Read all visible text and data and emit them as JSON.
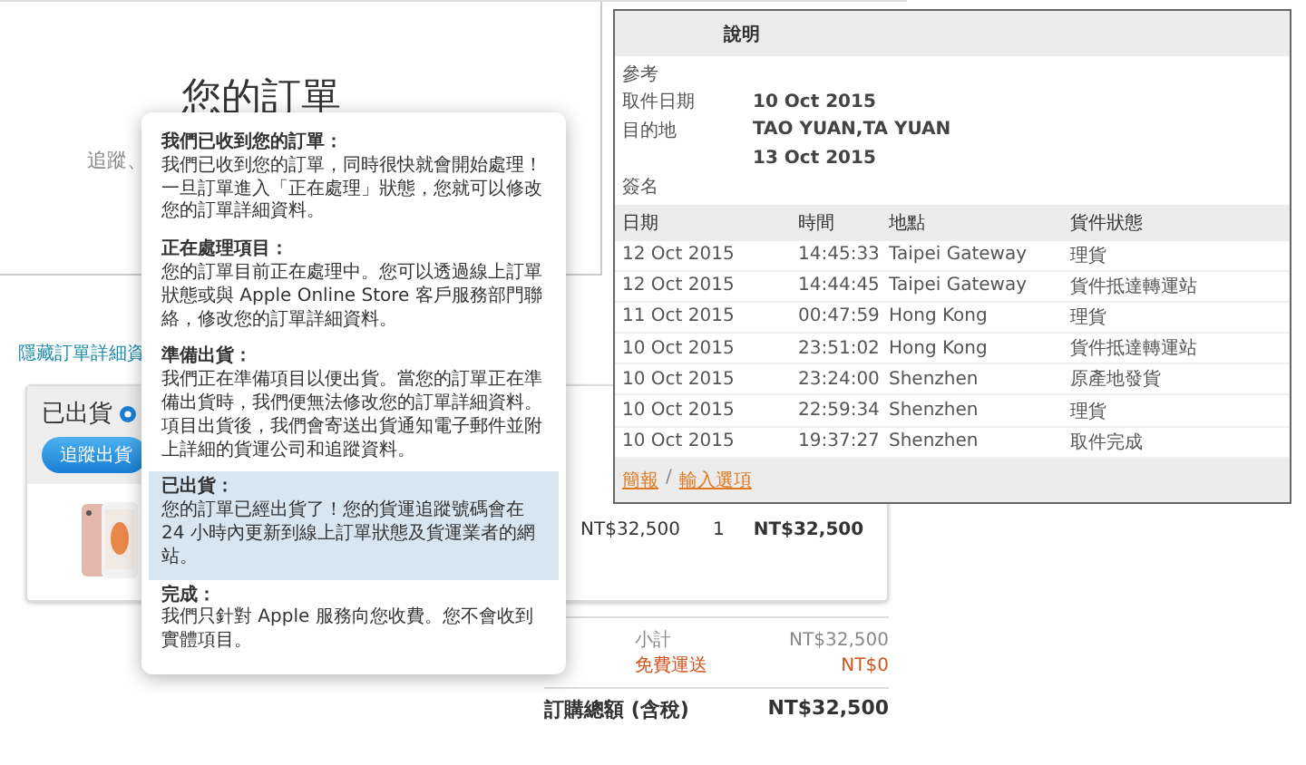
{
  "page": {
    "title": "您的訂單",
    "subtitle": "追蹤、",
    "hide_details_link": "隱藏訂單詳細資"
  },
  "shipment": {
    "status": "已出貨",
    "track_button": "追蹤出貨",
    "item": {
      "kind": "picture",
      "price": "NT$32,500",
      "quantity": "1",
      "total": "NT$32,500"
    }
  },
  "summary": [
    {
      "label": "小計",
      "value": "NT$32,500",
      "kind": "normal"
    },
    {
      "label": "免費運送",
      "value": "NT$0",
      "kind": "shipping"
    }
  ],
  "grand_total": {
    "label": "訂購總額 (含稅)",
    "value": "NT$32,500"
  },
  "status_popover": {
    "sections": [
      {
        "title": "我們已收到您的訂單：",
        "text": "我們已收到您的訂單，同時很快就會開始處理！一旦訂單進入「正在處理」狀態，您就可以修改您的訂單詳細資料。",
        "selected": false
      },
      {
        "title": "正在處理項目：",
        "text": "您的訂單目前正在處理中。您可以透過線上訂單狀態或與 Apple Online Store 客戶服務部門聯絡，修改您的訂單詳細資料。",
        "selected": false
      },
      {
        "title": "準備出貨：",
        "text": "我們正在準備項目以便出貨。當您的訂單正在準備出貨時，我們便無法修改您的訂單詳細資料。項目出貨後，我們會寄送出貨通知電子郵件並附上詳細的貨運公司和追蹤資料。",
        "selected": false
      },
      {
        "title": "已出貨：",
        "text": "您的訂單已經出貨了！您的貨運追蹤號碼會在 24 小時內更新到線上訂單狀態及貨運業者的網站。",
        "selected": true
      },
      {
        "title": "完成：",
        "text": "我們只針對 Apple 服務向您收費。您不會收到實體項目。",
        "selected": false
      }
    ]
  },
  "tracking": {
    "title": "說明",
    "details": [
      {
        "label": "參考"
      },
      {
        "label": "取件日期",
        "value": "10 Oct 2015"
      },
      {
        "label": "目的地",
        "value": "TAO YUAN,TA YUAN"
      },
      {
        "value": "13 Oct 2015"
      },
      {
        "label": "簽名"
      }
    ],
    "columns": [
      "日期",
      "時間",
      "地點",
      "貨件狀態"
    ],
    "rows": [
      [
        "12 Oct 2015",
        "14:45:33",
        "Taipei Gateway",
        "理貨"
      ],
      [
        "12 Oct 2015",
        "14:44:45",
        "Taipei Gateway",
        "貨件抵達轉運站"
      ],
      [
        "11 Oct 2015",
        "00:47:59",
        "Hong Kong",
        "理貨"
      ],
      [
        "10 Oct 2015",
        "23:51:02",
        "Hong Kong",
        "貨件抵達轉運站"
      ],
      [
        "10 Oct 2015",
        "23:24:00",
        "Shenzhen",
        "原產地發貨"
      ],
      [
        "10 Oct 2015",
        "22:59:34",
        "Shenzhen",
        "理貨"
      ],
      [
        "10 Oct 2015",
        "19:37:27",
        "Shenzhen",
        "取件完成"
      ]
    ],
    "footer_links": [
      "簡報",
      "輸入選項"
    ],
    "footer_separator": "/"
  }
}
